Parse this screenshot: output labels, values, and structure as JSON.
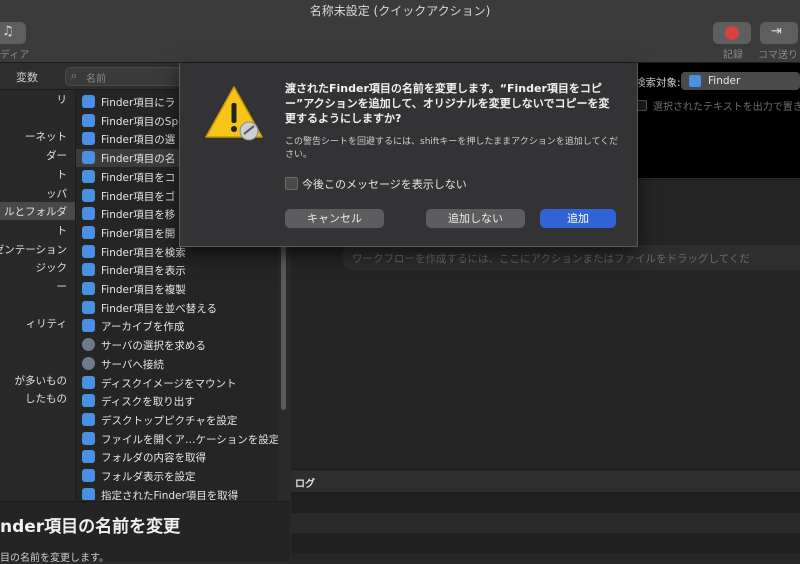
{
  "window": {
    "title": "名称未設定 (クイックアクション)"
  },
  "toolbar": {
    "left_label": "ディア",
    "record_label": "記録",
    "step_label": "コマ送り"
  },
  "library": {
    "variables_tab": "変数",
    "search_placeholder": "名前",
    "categories": [
      {
        "label": "リ"
      },
      {
        "label": ""
      },
      {
        "label": "ーネット"
      },
      {
        "label": "ダー"
      },
      {
        "label": "ト"
      },
      {
        "label": "ッパ"
      },
      {
        "label": "ルとフォルダ",
        "selected": true
      },
      {
        "label": "ト"
      },
      {
        "label": "ゼンテーション"
      },
      {
        "label": "ジック"
      },
      {
        "label": "ー"
      },
      {
        "label": ""
      },
      {
        "label": "ィリティ"
      },
      {
        "label": ""
      },
      {
        "label": ""
      },
      {
        "label": "が多いもの"
      },
      {
        "label": "したもの"
      }
    ],
    "actions": [
      {
        "label": "Finder項目にラ",
        "icon": "finder-icon"
      },
      {
        "label": "Finder項目のSp",
        "icon": "finder-icon"
      },
      {
        "label": "Finder項目の選",
        "icon": "finder-icon"
      },
      {
        "label": "Finder項目の名",
        "icon": "finder-icon",
        "selected": true
      },
      {
        "label": "Finder項目をコ",
        "icon": "finder-icon"
      },
      {
        "label": "Finder項目をゴ",
        "icon": "finder-icon"
      },
      {
        "label": "Finder項目を移",
        "icon": "finder-icon"
      },
      {
        "label": "Finder項目を開",
        "icon": "finder-icon"
      },
      {
        "label": "Finder項目を検索",
        "icon": "finder-icon"
      },
      {
        "label": "Finder項目を表示",
        "icon": "finder-icon"
      },
      {
        "label": "Finder項目を複製",
        "icon": "finder-icon"
      },
      {
        "label": "Finder項目を並べ替える",
        "icon": "finder-icon"
      },
      {
        "label": "アーカイブを作成",
        "icon": "finder-icon"
      },
      {
        "label": "サーバの選択を求める",
        "icon": "globe-icon"
      },
      {
        "label": "サーバへ接続",
        "icon": "globe-icon"
      },
      {
        "label": "ディスクイメージをマウント",
        "icon": "finder-icon"
      },
      {
        "label": "ディスクを取り出す",
        "icon": "finder-icon"
      },
      {
        "label": "デスクトップピクチャを設定",
        "icon": "finder-icon"
      },
      {
        "label": "ファイルを開くア…ケーションを設定",
        "icon": "finder-icon"
      },
      {
        "label": "フォルダの内容を取得",
        "icon": "finder-icon"
      },
      {
        "label": "フォルダ表示を設定",
        "icon": "finder-icon"
      },
      {
        "label": "指定されたFinder項目を取得",
        "icon": "finder-icon"
      }
    ]
  },
  "description": {
    "title": "nder項目の名前を変更",
    "subtitle": "目の名前を変更します。"
  },
  "workflow": {
    "target_label": "検索対象:",
    "target_value": "Finder",
    "output_label": "選択されたテキストを出力で置き",
    "drop_hint": "ワークフローを作成するには、ここにアクションまたはファイルをドラッグしてくだ"
  },
  "log": {
    "title": "ログ"
  },
  "sheet": {
    "title": "渡されたFinder項目の名前を変更します。“Finder項目をコピー”アクションを追加して、オリジナルを変更しないでコピーを変更するようにしますか?",
    "body": "この警告シートを回避するには、shiftキーを押したままアクションを追加してください。",
    "suppress_label": "今後このメッセージを表示しない",
    "cancel": "キャンセル",
    "dont_add": "追加しない",
    "add": "追加"
  },
  "colors": {
    "accent": "#2f63d6",
    "warning": "#f5c518",
    "finder": "#4a90e2",
    "record": "#d94141"
  }
}
